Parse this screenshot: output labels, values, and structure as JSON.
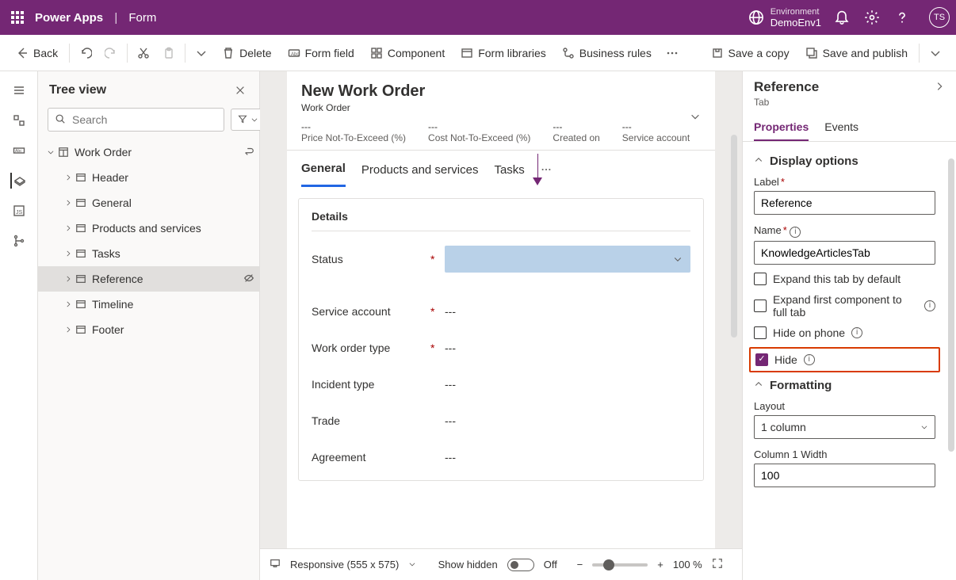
{
  "header": {
    "product": "Power Apps",
    "breadcrumb": "Form",
    "env_label": "Environment",
    "env_name": "DemoEnv1",
    "avatar": "TS"
  },
  "cmdbar": {
    "back": "Back",
    "delete": "Delete",
    "form_field": "Form field",
    "component": "Component",
    "form_libraries": "Form libraries",
    "business_rules": "Business rules",
    "save_copy": "Save a copy",
    "save_publish": "Save and publish"
  },
  "tree": {
    "title": "Tree view",
    "search_placeholder": "Search",
    "nodes": [
      {
        "label": "Work Order",
        "indent": 0,
        "exp": "v"
      },
      {
        "label": "Header",
        "indent": 1,
        "exp": ">"
      },
      {
        "label": "General",
        "indent": 1,
        "exp": ">"
      },
      {
        "label": "Products and services",
        "indent": 1,
        "exp": ">"
      },
      {
        "label": "Tasks",
        "indent": 1,
        "exp": ">"
      },
      {
        "label": "Reference",
        "indent": 1,
        "exp": ">",
        "selected": true
      },
      {
        "label": "Timeline",
        "indent": 1,
        "exp": ">"
      },
      {
        "label": "Footer",
        "indent": 1,
        "exp": ">"
      }
    ]
  },
  "form": {
    "title": "New Work Order",
    "entity": "Work Order",
    "summary": [
      {
        "value": "---",
        "label": "Price Not-To-Exceed (%)"
      },
      {
        "value": "---",
        "label": "Cost Not-To-Exceed (%)"
      },
      {
        "value": "---",
        "label": "Created on"
      },
      {
        "value": "---",
        "label": "Service account"
      }
    ],
    "tabs": [
      "General",
      "Products and services",
      "Tasks"
    ],
    "active_tab": 0,
    "section": {
      "title": "Details",
      "fields": [
        {
          "label": "Status",
          "required": true,
          "type": "status"
        },
        {
          "label": "Service account",
          "required": true,
          "value": "---"
        },
        {
          "label": "Work order type",
          "required": true,
          "value": "---"
        },
        {
          "label": "Incident type",
          "required": false,
          "value": "---"
        },
        {
          "label": "Trade",
          "required": false,
          "value": "---"
        },
        {
          "label": "Agreement",
          "required": false,
          "value": "---"
        }
      ]
    }
  },
  "statusbar": {
    "responsive": "Responsive (555 x 575)",
    "show_hidden": "Show hidden",
    "toggle_label": "Off",
    "zoom": "100 %"
  },
  "props": {
    "title": "Reference",
    "subtitle": "Tab",
    "tabs": [
      "Properties",
      "Events"
    ],
    "active": 0,
    "display_section": "Display options",
    "label_lbl": "Label",
    "label_val": "Reference",
    "name_lbl": "Name",
    "name_val": "KnowledgeArticlesTab",
    "chk_expand": "Expand this tab by default",
    "chk_expand_full": "Expand first component to full tab",
    "chk_hide_phone": "Hide on phone",
    "chk_hide": "Hide",
    "format_section": "Formatting",
    "layout_lbl": "Layout",
    "layout_val": "1 column",
    "colwidth_lbl": "Column 1 Width",
    "colwidth_val": "100"
  }
}
